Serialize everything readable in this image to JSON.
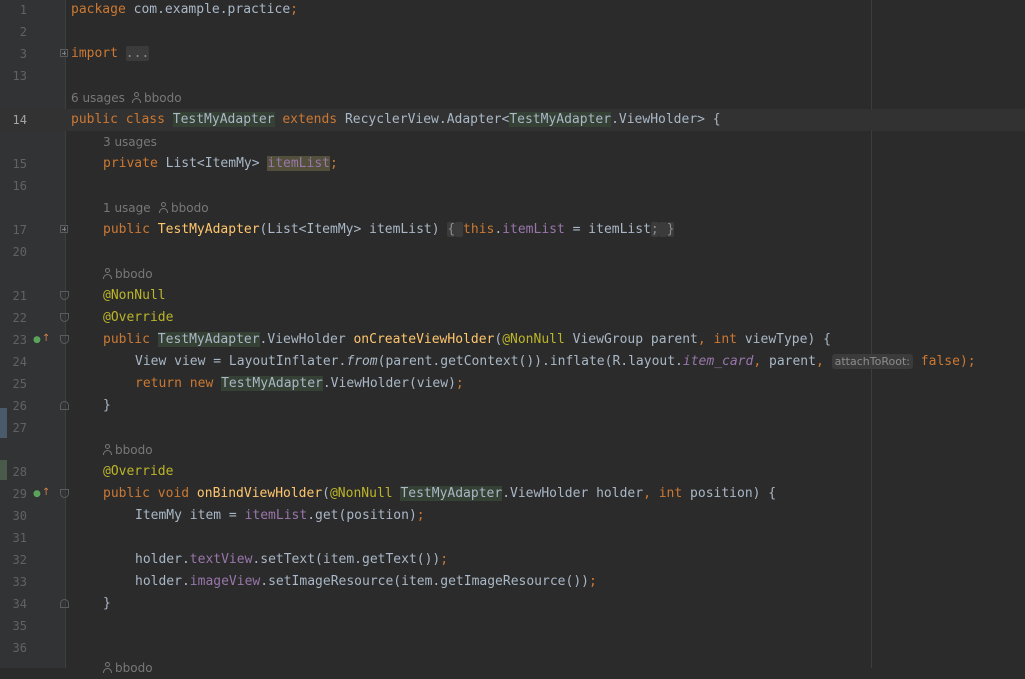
{
  "colors": {
    "background": "#2b2b2b",
    "gutter": "#313335",
    "keyword": "#cc7832",
    "annotation": "#bbb529",
    "method": "#ffc66d",
    "field": "#9876aa",
    "text": "#a9b7c6",
    "hint": "#787878"
  },
  "lines": {
    "l1": {
      "num": "1",
      "code": [
        "package",
        " com.example.practice",
        ";"
      ]
    },
    "l2": {
      "num": "2"
    },
    "l3": {
      "num": "3",
      "code": [
        "import",
        " ",
        "..."
      ]
    },
    "l13": {
      "num": "13"
    },
    "h14": {
      "usages": "6 usages",
      "author": "bbodo"
    },
    "l14": {
      "num": "14",
      "code": [
        "public class",
        " ",
        "TestMyAdapter",
        " ",
        "extends",
        " RecyclerView.Adapter<",
        "TestMyAdapter",
        ".ViewHolder> {"
      ]
    },
    "h15": {
      "usages": "3 usages"
    },
    "l15": {
      "num": "15",
      "code": [
        "private",
        " List<ItemMy> ",
        "itemList",
        ";"
      ]
    },
    "l16": {
      "num": "16"
    },
    "h17": {
      "usages": "1 usage",
      "author": "bbodo"
    },
    "l17": {
      "num": "17",
      "code": [
        "public",
        " ",
        "TestMyAdapter",
        "(List<ItemMy> itemList) ",
        "{",
        " ",
        "this",
        ".",
        "itemList",
        " = itemList",
        ";",
        " ",
        "}"
      ]
    },
    "l20": {
      "num": "20"
    },
    "h21": {
      "author": "bbodo"
    },
    "l21": {
      "num": "21",
      "code": [
        "@NonNull"
      ]
    },
    "l22": {
      "num": "22",
      "code": [
        "@Override"
      ]
    },
    "l23": {
      "num": "23",
      "code": [
        "public",
        " ",
        "TestMyAdapter",
        ".ViewHolder ",
        "onCreateViewHolder",
        "(",
        "@NonNull",
        " ViewGroup parent",
        ", ",
        "int",
        " viewType) {"
      ]
    },
    "l24": {
      "num": "24",
      "code": [
        "View view = LayoutInflater.",
        "from",
        "(parent.getContext()).inflate(R.layout.",
        "item_card",
        ", ",
        "parent",
        ", ",
        "attachToRoot:",
        " ",
        "false",
        ");"
      ]
    },
    "l25": {
      "num": "25",
      "code": [
        "return new",
        " ",
        "TestMyAdapter",
        ".ViewHolder(view)",
        ";"
      ]
    },
    "l26": {
      "num": "26",
      "code": [
        "}"
      ]
    },
    "l27": {
      "num": "27"
    },
    "h28": {
      "author": "bbodo"
    },
    "l28": {
      "num": "28",
      "code": [
        "@Override"
      ]
    },
    "l29": {
      "num": "29",
      "code": [
        "public void",
        " ",
        "onBindViewHolder",
        "(",
        "@NonNull",
        " ",
        "TestMyAdapter",
        ".ViewHolder holder",
        ", ",
        "int",
        " position) {"
      ]
    },
    "l30": {
      "num": "30",
      "code": [
        "ItemMy item = ",
        "itemList",
        ".get(position)",
        ";"
      ]
    },
    "l31": {
      "num": "31"
    },
    "l32": {
      "num": "32",
      "code": [
        "holder.",
        "textView",
        ".setText(item.getText())",
        ";"
      ]
    },
    "l33": {
      "num": "33",
      "code": [
        "holder.",
        "imageView",
        ".setImageResource(item.getImageResource())",
        ";"
      ]
    },
    "l34": {
      "num": "34",
      "code": [
        "}"
      ]
    },
    "l35": {
      "num": "35"
    },
    "l36": {
      "num": "36"
    },
    "h37": {
      "author": "bbodo"
    }
  },
  "icons": {
    "fold": "fold-icon",
    "implements": "implements-method-icon",
    "author": "person-icon"
  }
}
